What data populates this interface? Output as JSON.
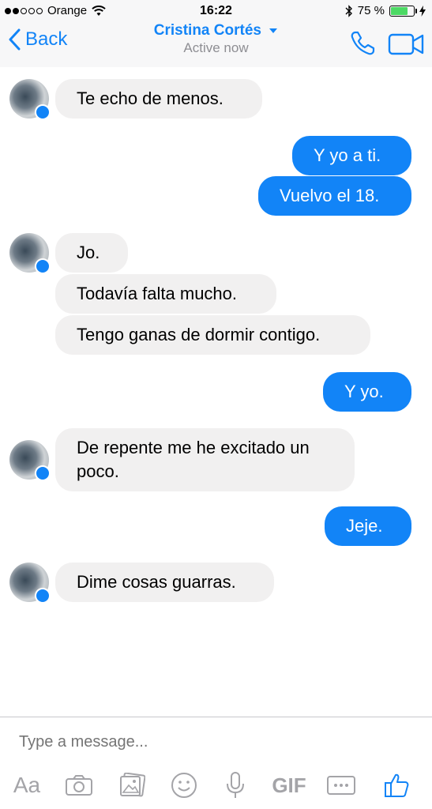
{
  "status_bar": {
    "carrier": "Orange",
    "time": "16:22",
    "battery_percent": "75 %",
    "battery_level": 0.75
  },
  "nav": {
    "back_label": "Back",
    "contact_name": "Cristina Cortés",
    "contact_status": "Active now"
  },
  "messages": [
    {
      "from": "contact",
      "text": "Te echo de menos."
    },
    {
      "from": "me",
      "text": "Y yo a ti."
    },
    {
      "from": "me",
      "text": "Vuelvo el 18."
    },
    {
      "from": "contact",
      "text": "Jo."
    },
    {
      "from": "contact",
      "text": "Todavía falta mucho."
    },
    {
      "from": "contact",
      "text": "Tengo ganas de dormir contigo."
    },
    {
      "from": "me",
      "text": "Y yo."
    },
    {
      "from": "contact",
      "text": "De repente me he excitado un poco."
    },
    {
      "from": "me",
      "text": "Jeje."
    },
    {
      "from": "contact",
      "text": "Dime cosas guarras."
    }
  ],
  "composer": {
    "placeholder": "Type a message...",
    "text_format_label": "Aa",
    "gif_label": "GIF"
  },
  "colors": {
    "accent": "#1284f7",
    "incoming_bubble": "#f1f0f0",
    "battery": "#4cd964"
  }
}
